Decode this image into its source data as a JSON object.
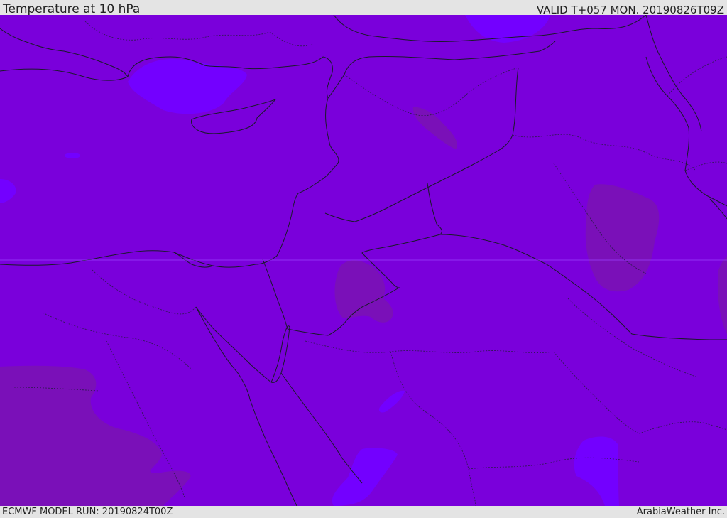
{
  "header": {
    "title": "Temperature at 10 hPa",
    "valid_time": "VALID T+057 MON. 20190826T09Z"
  },
  "footer": {
    "model_run": "ECMWF MODEL RUN: 20190824T00Z",
    "credit": "ArabiaWeather Inc."
  },
  "map": {
    "colors": {
      "base_field": "#7a00db",
      "cooler_field": "#7300ff",
      "warmer_field": "#7a10b8",
      "coastline": "#1a1a2a",
      "border": "#1a1a2a"
    }
  }
}
